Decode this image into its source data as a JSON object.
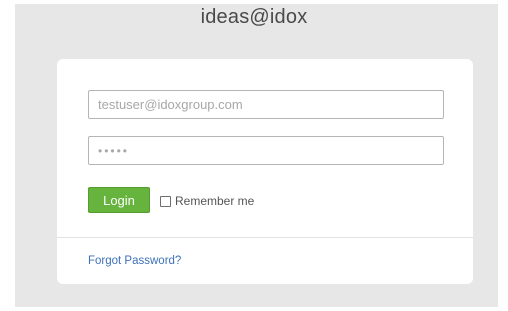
{
  "app": {
    "title": "ideas@idox"
  },
  "login": {
    "email_value": "testuser@idoxgroup.com",
    "password_masked": "•••••",
    "login_label": "Login",
    "remember_label": "Remember me",
    "remember_checked": false,
    "forgot_label": "Forgot Password?"
  },
  "colors": {
    "accent": "#66b33d",
    "link": "#3d72b8",
    "background": "#e7e7e7"
  }
}
